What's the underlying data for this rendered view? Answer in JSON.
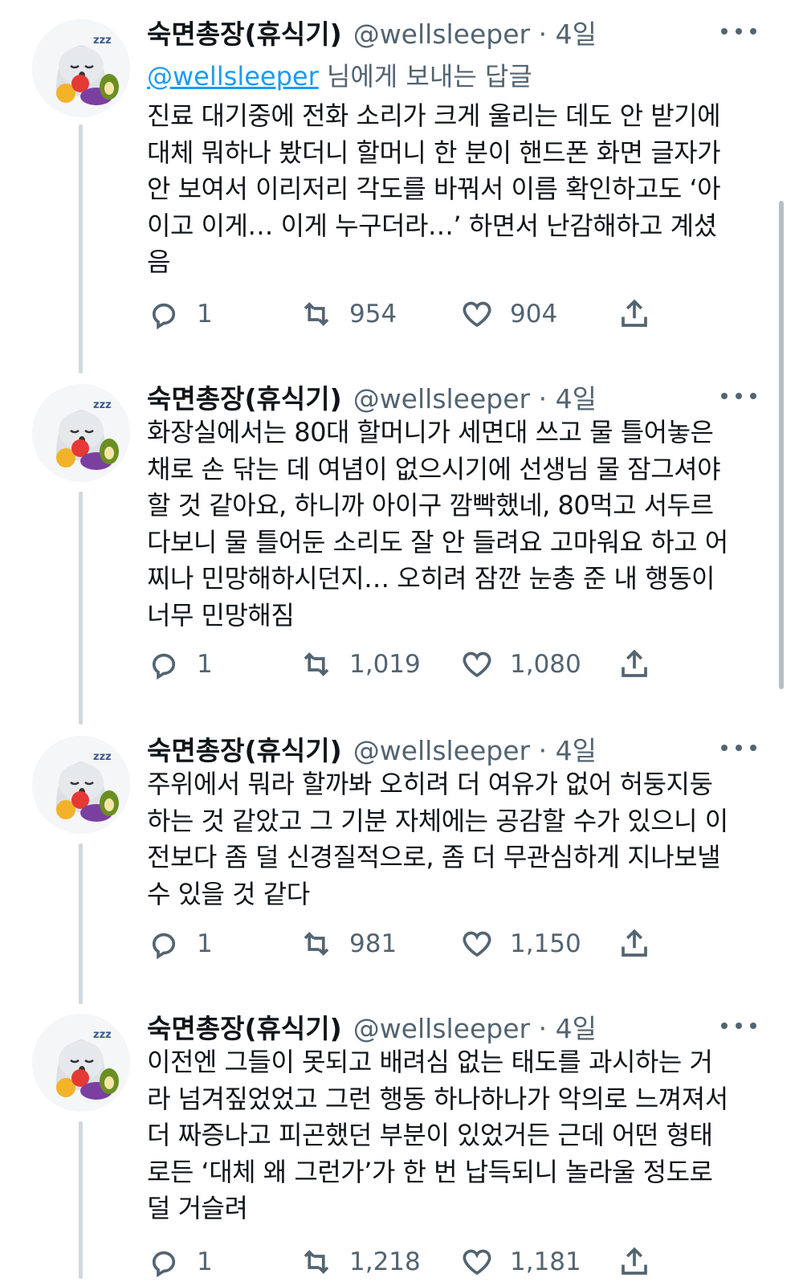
{
  "tweets": [
    {
      "name": "숙면총장(휴식기)",
      "handle": "@wellsleeper · 4일",
      "replying_mention": "@wellsleeper",
      "replying_suffix": " 님에게 보내는 답글",
      "text": "진료 대기중에 전화 소리가 크게 울리는 데도 안 받기에\n대체 뭐하나 봤더니 할머니 한 분이 핸드폰 화면 글자가\n안 보여서 이리저리 각도를 바꿔서 이름 확인하고도 ‘아\n이고 이게… 이게 누구더라…’ 하면서 난감해하고 계셨\n음",
      "reply_count": "1",
      "retweet_count": "954",
      "like_count": "904"
    },
    {
      "name": "숙면총장(휴식기)",
      "handle": "@wellsleeper · 4일",
      "text": "화장실에서는 80대 할머니가 세면대 쓰고 물 틀어놓은\n채로 손 닦는 데 여념이 없으시기에 선생님 물 잠그셔야\n할 것 같아요, 하니까 아이구 깜빡했네, 80먹고 서두르\n다보니 물 틀어둔 소리도 잘 안 들려요 고마워요 하고 어\n찌나 민망해하시던지… 오히려 잠깐 눈총 준 내 행동이\n너무 민망해짐",
      "reply_count": "1",
      "retweet_count": "1,019",
      "like_count": "1,080"
    },
    {
      "name": "숙면총장(휴식기)",
      "handle": "@wellsleeper · 4일",
      "text": "주위에서 뭐라 할까봐 오히려 더 여유가 없어 허둥지둥\n하는 것 같았고 그 기분 자체에는 공감할 수가 있으니 이\n전보다 좀 덜 신경질적으로, 좀 더 무관심하게 지나보낼\n수 있을 것 같다",
      "reply_count": "1",
      "retweet_count": "981",
      "like_count": "1,150"
    },
    {
      "name": "숙면총장(휴식기)",
      "handle": "@wellsleeper · 4일",
      "text": "이전엔 그들이 못되고 배려심 없는 태도를 과시하는 거\n라 넘겨짚었었고 그런 행동 하나하나가 악의로 느껴져서\n더 짜증나고 피곤했던 부분이 있었거든 근데 어떤 형태\n로든 ‘대체 왜 그런가’가 한 번 납득되니 놀라울 정도로\n덜 거슬려",
      "reply_count": "1",
      "retweet_count": "1,218",
      "like_count": "1,181"
    }
  ],
  "icons": [
    "reply-icon",
    "retweet-icon",
    "like-icon",
    "share-icon",
    "more-icon",
    "avatar-ghost-icon"
  ],
  "colors": {
    "text": "#0f1419",
    "muted": "#536471",
    "link": "#1d9bf0",
    "thread_line": "#cfd9de"
  }
}
